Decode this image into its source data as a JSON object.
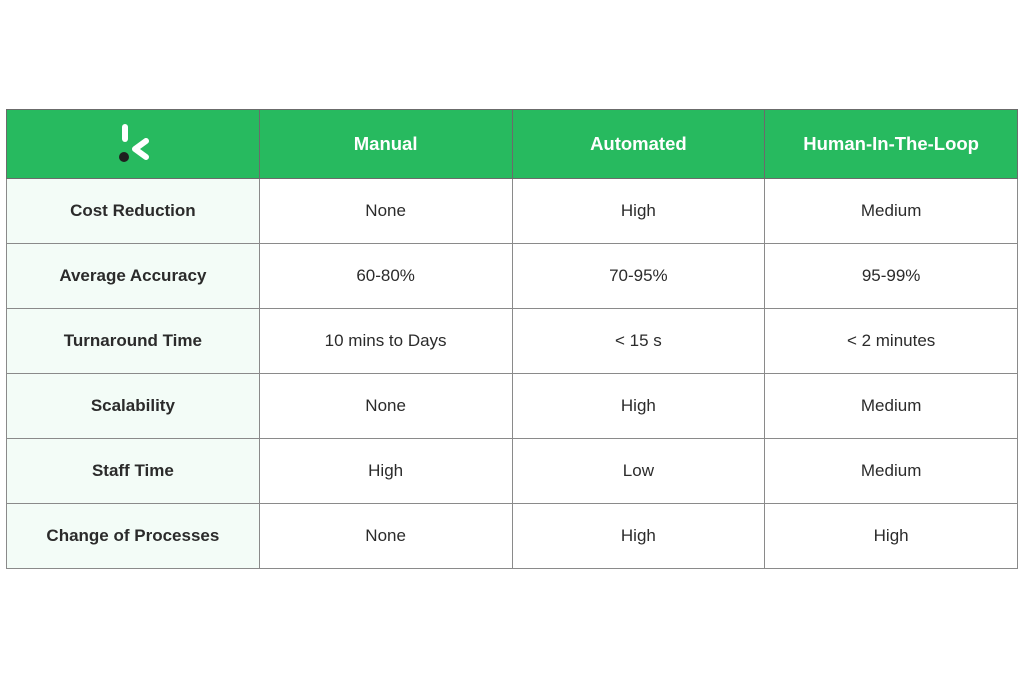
{
  "table": {
    "header": {
      "logo_icon": "kickstart-logo-icon",
      "columns": [
        "Manual",
        "Automated",
        "Human-In-The-Loop"
      ]
    },
    "rows": [
      {
        "label": "Cost Reduction",
        "values": [
          "None",
          "High",
          "Medium"
        ]
      },
      {
        "label": "Average Accuracy",
        "values": [
          "60-80%",
          "70-95%",
          "95-99%"
        ]
      },
      {
        "label": "Turnaround Time",
        "values": [
          "10 mins to Days",
          "< 15 s",
          "< 2 minutes"
        ]
      },
      {
        "label": "Scalability",
        "values": [
          "None",
          "High",
          "Medium"
        ]
      },
      {
        "label": "Staff Time",
        "values": [
          "High",
          "Low",
          "Medium"
        ]
      },
      {
        "label": "Change of Processes",
        "values": [
          "None",
          "High",
          "High"
        ]
      }
    ]
  },
  "colors": {
    "header_bg": "#27ba5f",
    "row_label_bg": "#f3fcf7",
    "header_text": "#ffffff",
    "body_text": "#2b2b2b"
  }
}
